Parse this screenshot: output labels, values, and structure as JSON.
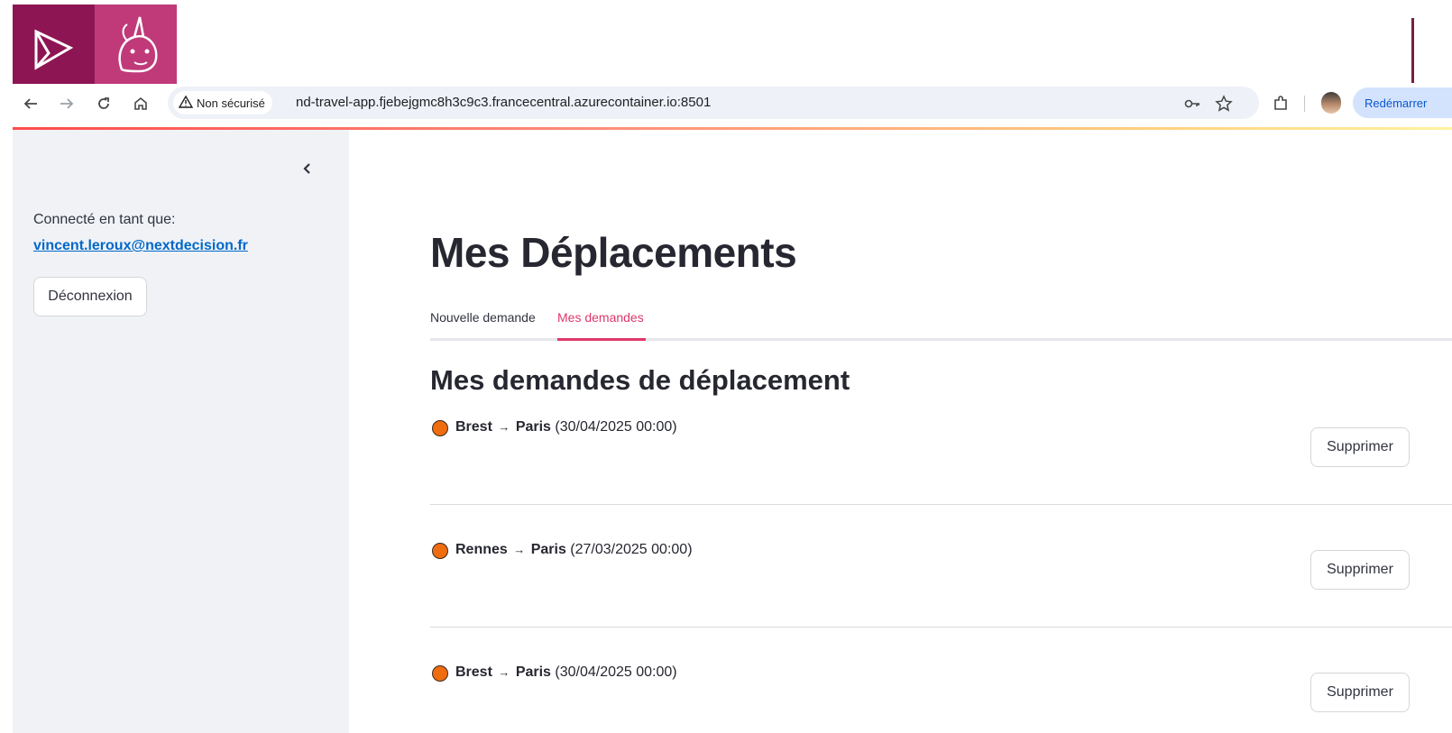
{
  "browser": {
    "security_label": "Non sécurisé",
    "url": "nd-travel-app.fjebejgmc8h3c9c3.francecentral.azurecontainer.io:8501",
    "restart_label": "Redémarrer",
    "icons": [
      "back-arrow-icon",
      "forward-arrow-icon",
      "reload-icon",
      "home-icon",
      "warning-icon",
      "key-icon",
      "star-icon",
      "extensions-icon",
      "profile-avatar"
    ]
  },
  "sidebar": {
    "logged_in_label": "Connecté en tant que:",
    "user_email": "vincent.leroux@nextdecision.fr",
    "logout_label": "Déconnexion"
  },
  "main": {
    "title": "Mes Déplacements",
    "tabs": [
      {
        "label": "Nouvelle demande",
        "active": false
      },
      {
        "label": "Mes demandes",
        "active": true
      }
    ],
    "section_title": "Mes demandes de déplacement",
    "trips": [
      {
        "origin": "Brest",
        "arrow": "→",
        "destination": "Paris",
        "date": "(30/04/2025 00:00)",
        "status_color": "#ef6c0f",
        "action_label": "Supprimer"
      },
      {
        "origin": "Rennes",
        "arrow": "→",
        "destination": "Paris",
        "date": "(27/03/2025 00:00)",
        "status_color": "#ef6c0f",
        "action_label": "Supprimer"
      },
      {
        "origin": "Brest",
        "arrow": "→",
        "destination": "Paris",
        "date": "(30/04/2025 00:00)",
        "status_color": "#ef6c0f",
        "action_label": "Supprimer"
      }
    ]
  },
  "colors": {
    "accent": "#e0376b",
    "link": "#0068c9",
    "sidebar_bg": "#f0f2f6",
    "logo_primary": "#8e1553",
    "logo_secondary": "#c03a7a"
  }
}
